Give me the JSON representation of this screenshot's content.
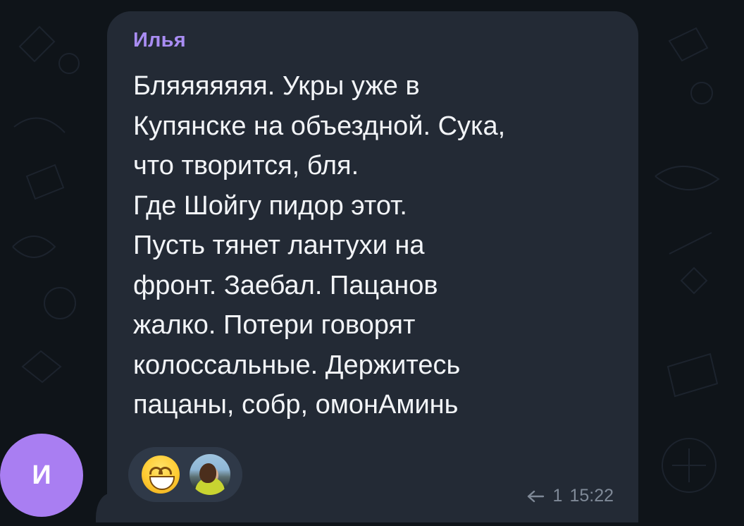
{
  "message": {
    "sender": "Илья",
    "text": "Бляяяяяяя. Укры уже в\nКупянске на объездной. Сука,\nчто творится, бля.\nГде Шойгу пидор этот.\nПусть тянет лантухи на\nфронт. Заебал. Пацанов\nжалко. Потери говорят\nколоссальные. Держитесь\nпацаны, собр, омонАминь",
    "reply_count": "1",
    "time": "15:22"
  },
  "avatar": {
    "initial": "И"
  },
  "colors": {
    "background": "#0f1419",
    "bubble": "#232a35",
    "sender": "#a98df3",
    "avatar": "#a97ef2",
    "meta": "#7f8997"
  },
  "icons": {
    "reply": "reply-icon",
    "reaction_emoji": "grinning-face-icon"
  }
}
